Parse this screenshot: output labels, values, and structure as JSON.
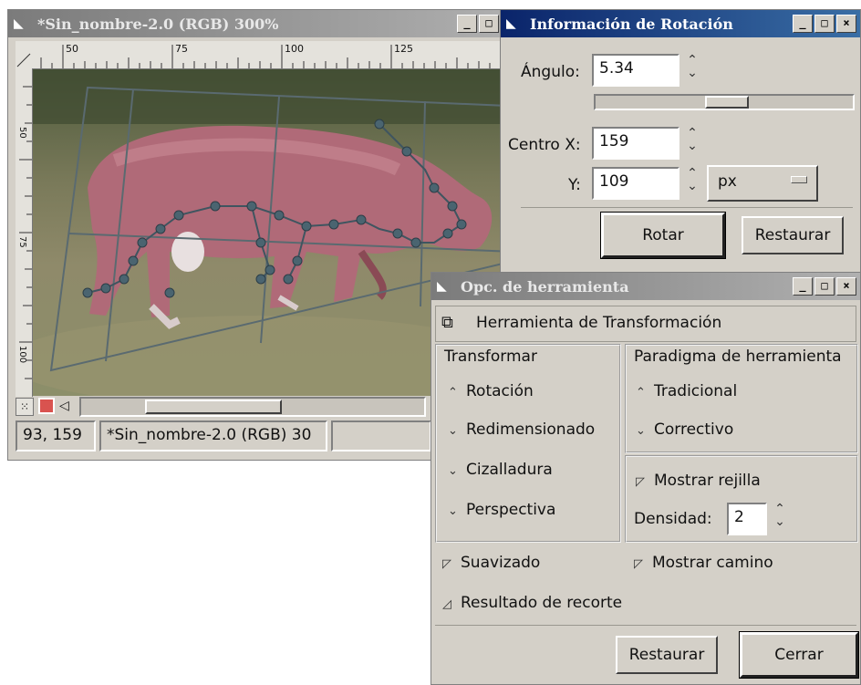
{
  "image_window": {
    "title": "*Sin_nombre-2.0 (RGB) 300%",
    "ruler_marks": [
      "50",
      "75",
      "100",
      "125"
    ],
    "vruler_marks": [
      "50",
      "75",
      "100"
    ],
    "coords": "93, 159",
    "status": "*Sin_nombre-2.0 (RGB) 30"
  },
  "rotation_dialog": {
    "title": "Información de Rotación",
    "angle_label": "Ángulo:",
    "angle_value": "5.34",
    "center_x_label": "Centro X:",
    "center_x_value": "159",
    "y_label": "Y:",
    "y_value": "109",
    "unit": "px",
    "rotate_button": "Rotar",
    "reset_button": "Restaurar"
  },
  "tool_options": {
    "title": "Opc. de herramienta",
    "tool_name": "Herramienta de Transformación",
    "transform_heading": "Transformar",
    "transform_options": [
      "Rotación",
      "Redimensionado",
      "Cizalladura",
      "Perspectiva"
    ],
    "paradigm_heading": "Paradigma de herramienta",
    "paradigm_options": [
      "Tradicional",
      "Correctivo"
    ],
    "show_grid": "Mostrar rejilla",
    "density_label": "Densidad:",
    "density_value": "2",
    "smoothing": "Suavizado",
    "show_path": "Mostrar camino",
    "clip_result": "Resultado de recorte",
    "reset_button": "Restaurar",
    "close_button": "Cerrar"
  },
  "colors": {
    "title_active": "#0a246a",
    "title_inactive": "#808080",
    "dialog_bg": "#d4d0c8"
  }
}
